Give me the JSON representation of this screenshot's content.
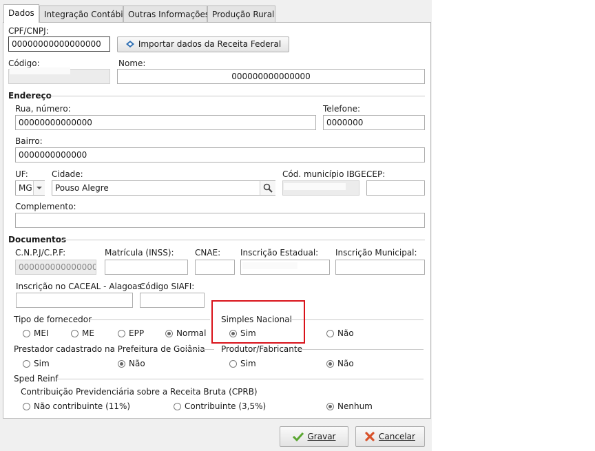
{
  "tabs": [
    "Dados",
    "Integração Contábil",
    "Outras Informações",
    "Produção Rural"
  ],
  "cpf_label": "CPF/CNPJ:",
  "cpf_value": "00000000000000000",
  "import_button": "Importar dados da Receita Federal",
  "codigo_label": "Código:",
  "nome_label": "Nome:",
  "nome_value": "000000000000000",
  "endereco": {
    "title": "Endereço",
    "rua_label": "Rua, número:",
    "rua_value": "00000000000000",
    "telefone_label": "Telefone:",
    "telefone_value": "0000000",
    "bairro_label": "Bairro:",
    "bairro_value": "0000000000000",
    "uf_label": "UF:",
    "uf_value": "MG",
    "cidade_label": "Cidade:",
    "cidade_value": "Pouso Alegre",
    "ibge_label": "Cód. município IBGE:",
    "cep_label": "CEP:",
    "complemento_label": "Complemento:"
  },
  "documentos": {
    "title": "Documentos",
    "cnpj_label": "C.N.P.J/C.P.F:",
    "cnpj_value": "00000000000000000",
    "matricula_label": "Matrícula (INSS):",
    "cnae_label": "CNAE:",
    "ie_label": "Inscrição Estadual:",
    "im_label": "Inscrição Municipal:",
    "caceal_label": "Inscrição no CACEAL - Alagoas:",
    "siafi_label": "Código SIAFI:"
  },
  "tipo_fornecedor": {
    "title": "Tipo de fornecedor",
    "options": [
      "MEI",
      "ME",
      "EPP",
      "Normal"
    ]
  },
  "simples_nacional": {
    "title": "Simples Nacional",
    "options": [
      "Sim",
      "Não"
    ]
  },
  "prestador": {
    "title": "Prestador cadastrado na Prefeitura de Goiânia",
    "options": [
      "Sim",
      "Não"
    ]
  },
  "produtor": {
    "title": "Produtor/Fabricante",
    "options": [
      "Sim",
      "Não"
    ]
  },
  "sped": {
    "title": "Sped Reinf",
    "subtitle": "Contribuição Previdenciária sobre a Receita Bruta (CPRB)",
    "options": [
      "Não contribuinte (11%)",
      "Contribuinte (3,5%)",
      "Nenhum"
    ]
  },
  "footer": {
    "save_label": "Gravar",
    "cancel_label": "Cancelar"
  },
  "colors": {
    "highlight": "#d9121a",
    "save_icon": "#5aa631",
    "cancel_icon": "#d8522b"
  }
}
